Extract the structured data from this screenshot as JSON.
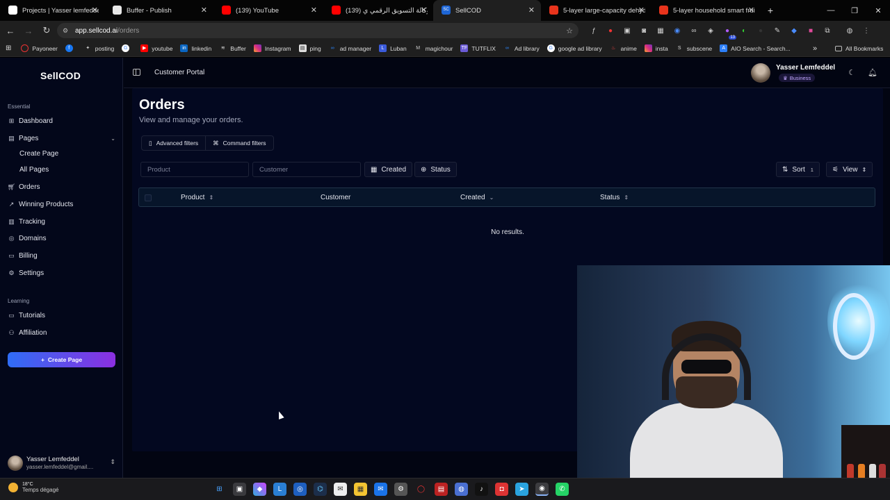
{
  "browser": {
    "tabs": [
      {
        "title": "Projects | Yasser lemfeddel's …",
        "color": "#ffffff"
      },
      {
        "title": "Buffer - Publish",
        "color": "#ffffff"
      },
      {
        "title": "(139) YouTube",
        "color": "#ff0000"
      },
      {
        "title": "(139) وكالة التسويق الرقمي ي…",
        "color": "#ff0000"
      },
      {
        "title": "SellCOD",
        "color": "#1e66d6"
      },
      {
        "title": "5-layer large-capacity dehydr…",
        "color": "#e8341c"
      },
      {
        "title": "5-layer household smart frui…",
        "color": "#e8341c"
      }
    ],
    "url_host": "app.sellcod.ai",
    "url_path": "/orders",
    "bookmarks": [
      "Payoneer",
      "posting",
      "",
      "youtube",
      "linkedin",
      "Buffer",
      "Instagram",
      "ping",
      "ad manager",
      "Luban",
      "magichour",
      "TUTFLIX",
      "Ad library",
      "google ad library",
      "anime",
      "insta",
      "subscene",
      "AIO Search - Search..."
    ],
    "all_bookmarks": "All Bookmarks",
    "ext_badge": "13"
  },
  "app": {
    "logo": "SellCOD",
    "sections": {
      "essential": "Essential",
      "learning": "Learning"
    },
    "nav": {
      "dashboard": "Dashboard",
      "pages": "Pages",
      "create_page": "Create Page",
      "all_pages": "All Pages",
      "orders": "Orders",
      "winning_products": "Winning Products",
      "tracking": "Tracking",
      "domains": "Domains",
      "billing": "Billing",
      "settings": "Settings",
      "tutorials": "Tutorials",
      "affiliation": "Affiliation"
    },
    "create_button": "Create Page",
    "user": {
      "name": "Yasser Lemfeddel",
      "email": "yasser.lemfeddel@gmail...."
    },
    "topbar": {
      "portal": "Customer Portal",
      "user_name": "Yasser Lemfeddel",
      "plan": "Business"
    },
    "page": {
      "title": "Orders",
      "subtitle": "View and manage your orders.",
      "advanced_filters": "Advanced filters",
      "command_filters": "Command filters",
      "product_placeholder": "Product",
      "customer_placeholder": "Customer",
      "created_btn": "Created",
      "status_btn": "Status",
      "sort_btn": "Sort",
      "sort_count": "1",
      "view_btn": "View",
      "columns": [
        "Product",
        "Customer",
        "Created",
        "Status"
      ],
      "empty": "No results."
    }
  },
  "taskbar": {
    "temp": "18°C",
    "weather": "Temps dégagé"
  }
}
